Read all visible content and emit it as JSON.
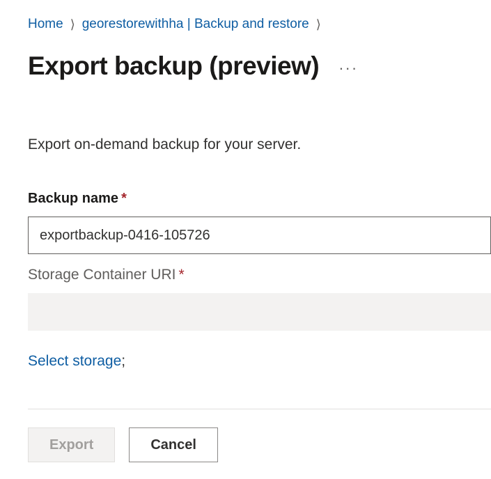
{
  "breadcrumb": {
    "home": "Home",
    "resource": "georestorewithha | Backup and restore"
  },
  "page": {
    "title": "Export backup (preview)",
    "description": "Export on-demand backup for your server."
  },
  "form": {
    "backup_name_label": "Backup name",
    "backup_name_value": "exportbackup-0416-105726",
    "storage_uri_label": "Storage Container URI",
    "storage_uri_value": "",
    "select_storage_link": "Select storage"
  },
  "footer": {
    "export_label": "Export",
    "cancel_label": "Cancel"
  }
}
